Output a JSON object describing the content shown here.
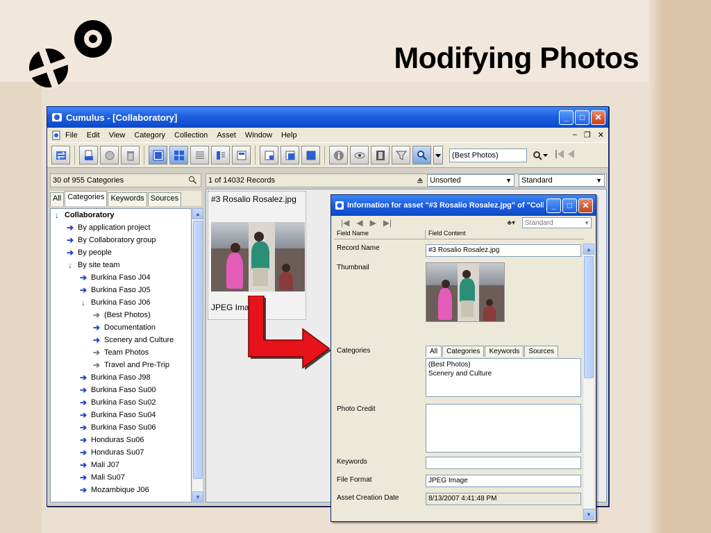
{
  "slide": {
    "title": "Modifying Photos"
  },
  "window": {
    "title": "Cumulus - [Collaboratory]",
    "menu": [
      "File",
      "Edit",
      "View",
      "Category",
      "Collection",
      "Asset",
      "Window",
      "Help"
    ],
    "toolbar_search": "(Best Photos)"
  },
  "left_pane": {
    "count": "30 of 955 Categories",
    "tabs": [
      "All",
      "Categories",
      "Keywords",
      "Sources"
    ],
    "tree": [
      {
        "label": "Collaboratory",
        "level": 0,
        "expanded": true,
        "bold": true
      },
      {
        "label": "By application project",
        "level": 1
      },
      {
        "label": "By Collaboratory group",
        "level": 1
      },
      {
        "label": "By people",
        "level": 1
      },
      {
        "label": "By site team",
        "level": 1,
        "expanded": true
      },
      {
        "label": "Burkina Faso J04",
        "level": 2
      },
      {
        "label": "Burkina Faso J05",
        "level": 2
      },
      {
        "label": "Burkina Faso J06",
        "level": 2,
        "expanded": true
      },
      {
        "label": "(Best Photos)",
        "level": 3,
        "grey": true
      },
      {
        "label": "Documentation",
        "level": 3
      },
      {
        "label": "Scenery and Culture",
        "level": 3
      },
      {
        "label": "Team Photos",
        "level": 3,
        "grey": true
      },
      {
        "label": "Travel and Pre-Trip",
        "level": 3,
        "grey": true
      },
      {
        "label": "Burkina Faso J98",
        "level": 2
      },
      {
        "label": "Burkina Faso Su00",
        "level": 2
      },
      {
        "label": "Burkina Faso Su02",
        "level": 2
      },
      {
        "label": "Burkina Faso Su04",
        "level": 2
      },
      {
        "label": "Burkina Faso Su06",
        "level": 2
      },
      {
        "label": "Honduras Su06",
        "level": 2
      },
      {
        "label": "Honduras Su07",
        "level": 2
      },
      {
        "label": "Mali J07",
        "level": 2
      },
      {
        "label": "Mali Su07",
        "level": 2
      },
      {
        "label": "Mozambique J06",
        "level": 2
      }
    ]
  },
  "right_pane": {
    "count": "1 of 14032 Records",
    "sort": "Unsorted",
    "view": "Standard",
    "card": {
      "name": "#3 Rosalio Rosalez.jpg",
      "format": "JPEG Ima"
    }
  },
  "dialog": {
    "title": "Information for asset \"#3 Rosalio Rosalez.jpg\" of \"Coll...",
    "view": "Standard",
    "col_name": "Field Name",
    "col_content": "Field Content",
    "fields": {
      "record_name_label": "Record Name",
      "record_name": "#3 Rosalio Rosalez.jpg",
      "thumbnail_label": "Thumbnail",
      "categories_label": "Categories",
      "cat_tabs": [
        "All",
        "Categories",
        "Keywords",
        "Sources"
      ],
      "categories": [
        "(Best Photos)",
        "Scenery and Culture"
      ],
      "photo_credit_label": "Photo Credit",
      "keywords_label": "Keywords",
      "file_format_label": "File Format",
      "file_format": "JPEG Image",
      "creation_date_label": "Asset Creation Date",
      "creation_date": "8/13/2007 4:41:48 PM"
    }
  },
  "colors": {
    "title_blue": "#0a49c8",
    "arrow_red": "#e8121a",
    "tree_arrow": "#1a3fc8"
  }
}
